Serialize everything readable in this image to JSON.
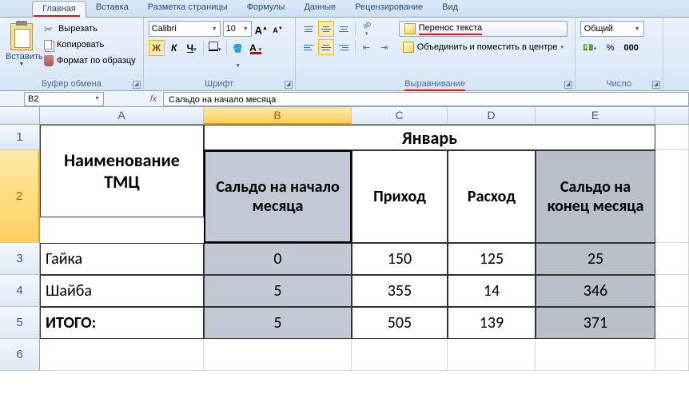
{
  "tabs": {
    "home": "Главная",
    "insert": "Вставка",
    "pagelayout": "Разметка страницы",
    "formulas": "Формулы",
    "data": "Данные",
    "review": "Рецензирование",
    "view": "Вид"
  },
  "clipboard": {
    "paste": "Вставить",
    "cut": "Вырезать",
    "copy": "Копировать",
    "formatpainter": "Формат по образцу",
    "group": "Буфер обмена"
  },
  "font": {
    "name": "Calibri",
    "size": "10",
    "group": "Шрифт",
    "bold": "Ж",
    "italic": "К",
    "underline": "Ч",
    "fill_color": "#ffff00",
    "font_color": "#c00000",
    "grow": "A",
    "shrink": "A"
  },
  "alignment": {
    "wrap": "Перенос текста",
    "merge": "Объединить и поместить в центре",
    "group": "Выравнивание"
  },
  "number": {
    "format": "Общий",
    "group": "Число"
  },
  "namebox": "B2",
  "formula": "Сальдо на начало месяца",
  "columns": [
    "A",
    "B",
    "C",
    "D",
    "E"
  ],
  "sheet": {
    "month": "Январь",
    "name_header": "Наименование ТМЦ",
    "col_b": "Сальдо на начало месяца",
    "col_c": "Приход",
    "col_d": "Расход",
    "col_e": "Сальдо на конец месяца",
    "rows": [
      {
        "name": "Гайка",
        "b": "0",
        "c": "150",
        "d": "125",
        "e": "25"
      },
      {
        "name": "Шайба",
        "b": "5",
        "c": "355",
        "d": "14",
        "e": "346"
      },
      {
        "name": "ИТОГО:",
        "b": "5",
        "c": "505",
        "d": "139",
        "e": "371"
      }
    ]
  },
  "chart_data": {
    "type": "table",
    "title": "Январь",
    "columns": [
      "Наименование ТМЦ",
      "Сальдо на начало месяца",
      "Приход",
      "Расход",
      "Сальдо на конец месяца"
    ],
    "rows": [
      [
        "Гайка",
        0,
        150,
        125,
        25
      ],
      [
        "Шайба",
        5,
        355,
        14,
        346
      ],
      [
        "ИТОГО:",
        5,
        505,
        139,
        371
      ]
    ]
  }
}
